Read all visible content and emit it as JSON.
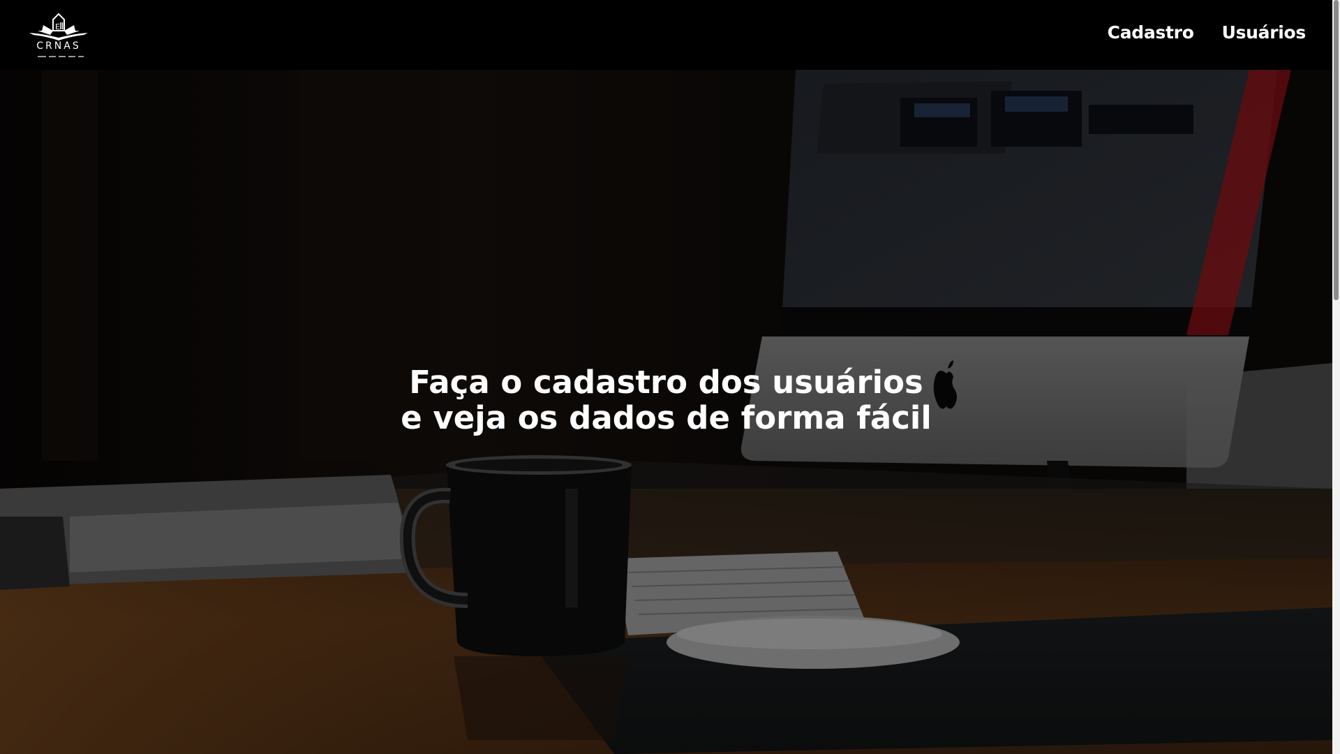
{
  "brand": {
    "name": "CRNAS",
    "logo_icon": "ship-icon"
  },
  "nav": {
    "items": [
      {
        "label": "Cadastro"
      },
      {
        "label": "Usuários"
      }
    ]
  },
  "hero": {
    "line1": "Faça o cadastro dos usuários",
    "line2": "e veja os dados de forma fácil",
    "background": "desk-with-imac-coffee-mug-photo"
  },
  "colors": {
    "navbar_bg": "#000000",
    "text": "#ffffff",
    "accent_red": "#c0141b"
  }
}
